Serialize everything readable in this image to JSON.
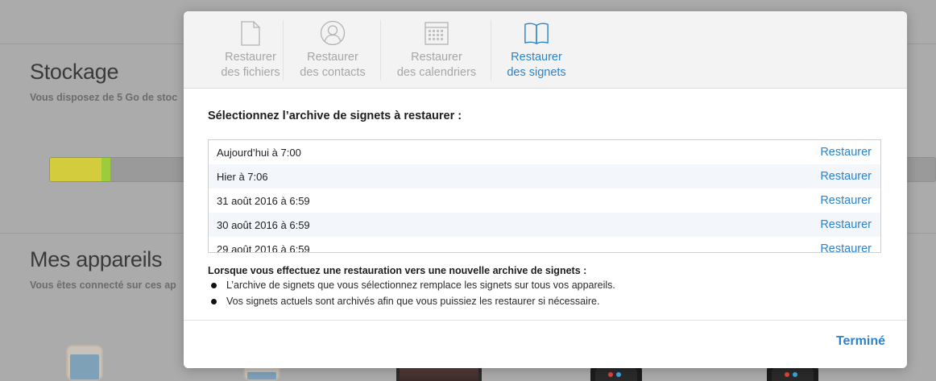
{
  "background": {
    "storage": {
      "title": "Stockage",
      "subtitle": "Vous disposez de 5 Go de stoc",
      "bar_colors": [
        "#d3cd3d",
        "#9ccb3b"
      ]
    },
    "devices": {
      "title": "Mes appareils",
      "subtitle": "Vous êtes connecté sur ces ap"
    }
  },
  "modal": {
    "tabs": [
      {
        "label": "Restaurer\ndes fichiers",
        "icon": "document-icon"
      },
      {
        "label": "Restaurer\ndes contacts",
        "icon": "contact-icon"
      },
      {
        "label": "Restaurer\ndes calendriers",
        "icon": "calendar-icon"
      },
      {
        "label": "Restaurer\ndes signets",
        "icon": "book-icon",
        "active": true
      }
    ],
    "heading": "Sélectionnez l’archive de signets à restaurer :",
    "archives": [
      {
        "date": "Aujourd’hui à 7:00",
        "action": "Restaurer"
      },
      {
        "date": "Hier à 7:06",
        "action": "Restaurer"
      },
      {
        "date": "31 août 2016 à 6:59",
        "action": "Restaurer"
      },
      {
        "date": "30 août 2016 à 6:59",
        "action": "Restaurer"
      },
      {
        "date": "29 août 2016 à 6:59",
        "action": "Restaurer"
      }
    ],
    "note": {
      "title": "Lorsque vous effectuez une restauration vers une nouvelle archive de signets :",
      "bullets": [
        "L’archive de signets que vous sélectionnez remplace les signets sur tous vos appareils.",
        "Vos signets actuels sont archivés afin que vous puissiez les restaurer si nécessaire."
      ]
    },
    "done_label": "Terminé",
    "accent_color": "#2d83c9"
  }
}
